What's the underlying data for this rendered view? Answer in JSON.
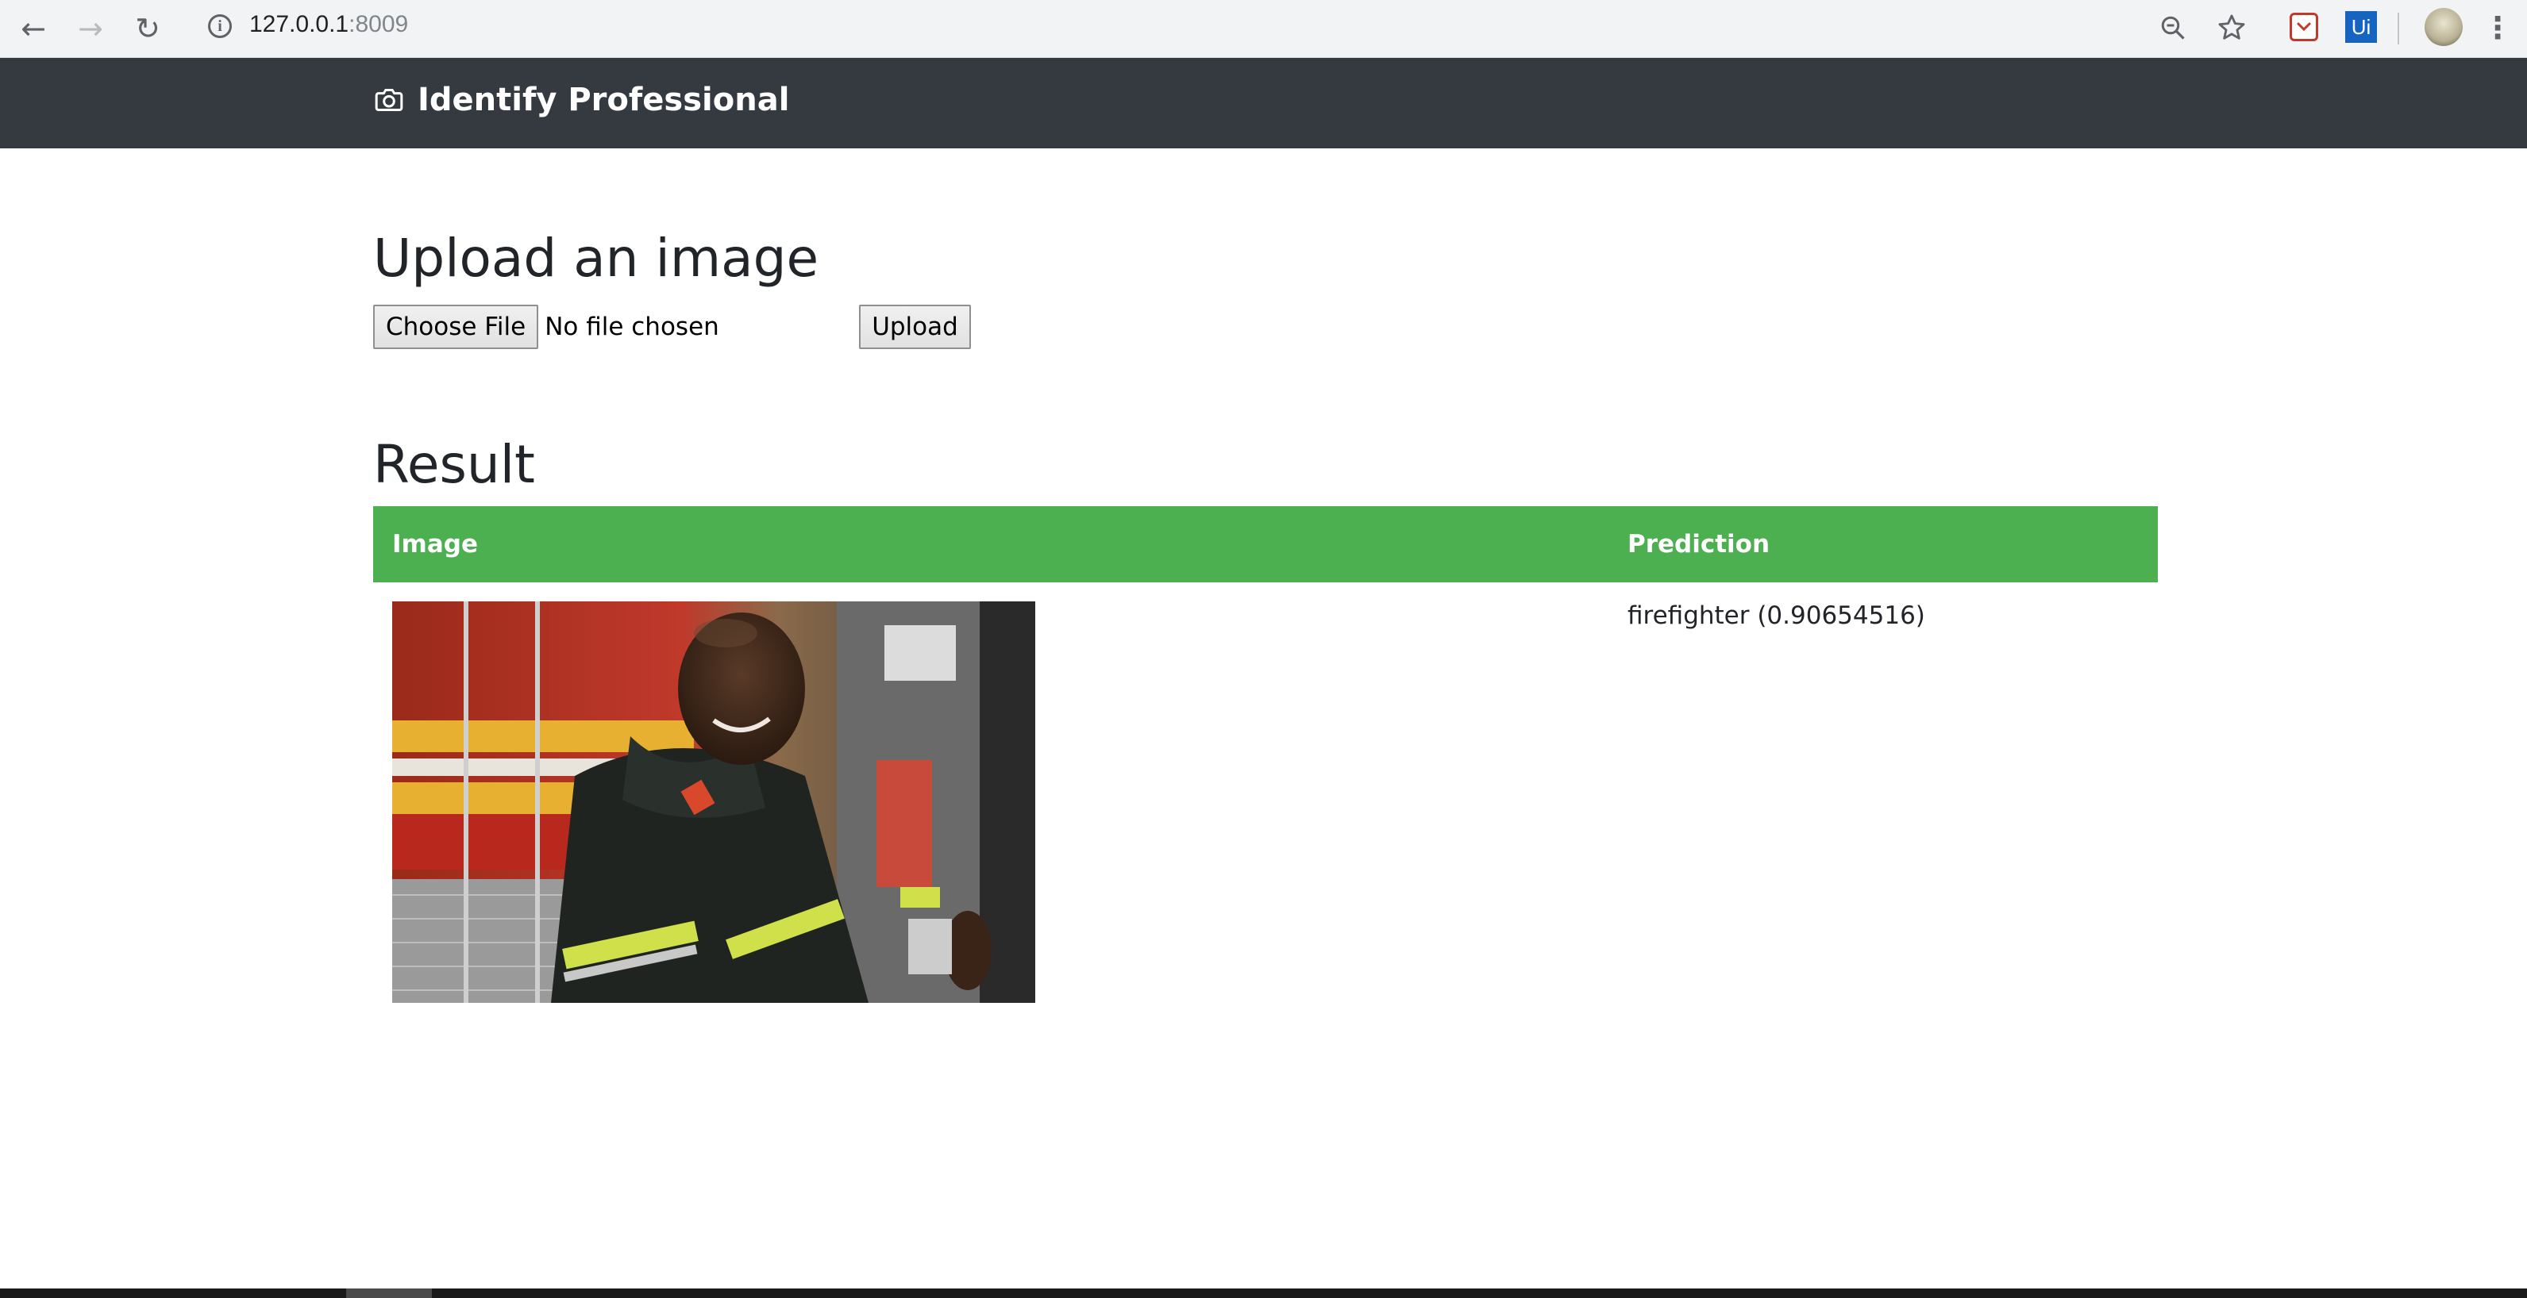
{
  "browser": {
    "url_host": "127.0.0.1",
    "url_port": ":8009",
    "icons": {
      "back": "back-arrow-icon",
      "forward": "forward-arrow-icon",
      "reload": "reload-icon",
      "info": "site-info-icon",
      "zoom": "zoom-out-icon",
      "bookmark": "bookmark-star-icon",
      "pocket": "pocket-extension-icon",
      "uipath": "uipath-extension-icon",
      "profile": "profile-avatar",
      "menu": "kebab-menu-icon"
    },
    "ext_ui_label": "Ui"
  },
  "navbar": {
    "brand_icon": "camera-icon",
    "brand_title": "Identify Professional",
    "background": "#343a40"
  },
  "upload": {
    "heading": "Upload an image",
    "choose_file_label": "Choose File",
    "file_status": "No file chosen",
    "upload_button_label": "Upload"
  },
  "result": {
    "heading": "Result",
    "header_color": "#4caf50",
    "columns": [
      "Image",
      "Prediction"
    ],
    "rows": [
      {
        "image": "firefighter-photo",
        "prediction": "firefighter (0.90654516)"
      }
    ]
  }
}
